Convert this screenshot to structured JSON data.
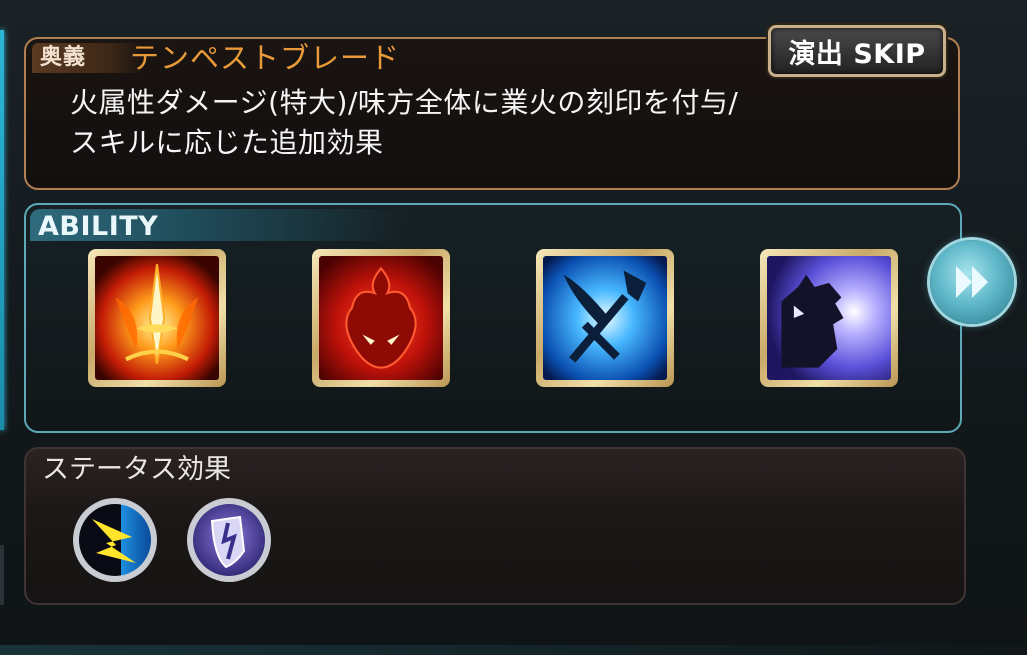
{
  "ougi": {
    "tag_label": "奥義",
    "name": "テンペストブレード",
    "description_line1": "火属性ダメージ(特大)/味方全体に業火の刻印を付与/",
    "description_line2": "スキルに応じた追加効果"
  },
  "skip_button": {
    "label": "演出 SKIP"
  },
  "ability": {
    "header": "ABILITY",
    "icons": [
      {
        "icon": "flame-sword-icon"
      },
      {
        "icon": "fire-demon-icon"
      },
      {
        "icon": "crossed-axe-sword-icon"
      },
      {
        "icon": "wolf-howl-icon"
      }
    ]
  },
  "next_button": {
    "icon": "fast-forward-icon"
  },
  "status": {
    "header": "ステータス効果",
    "icons": [
      {
        "icon": "lightning-buff-icon"
      },
      {
        "icon": "shield-buff-icon"
      }
    ]
  },
  "colors": {
    "ougi_name": "#e89a3a",
    "ougi_border": "#b07f52",
    "ability_border": "#5da9b8",
    "status_border": "#3f3431"
  }
}
